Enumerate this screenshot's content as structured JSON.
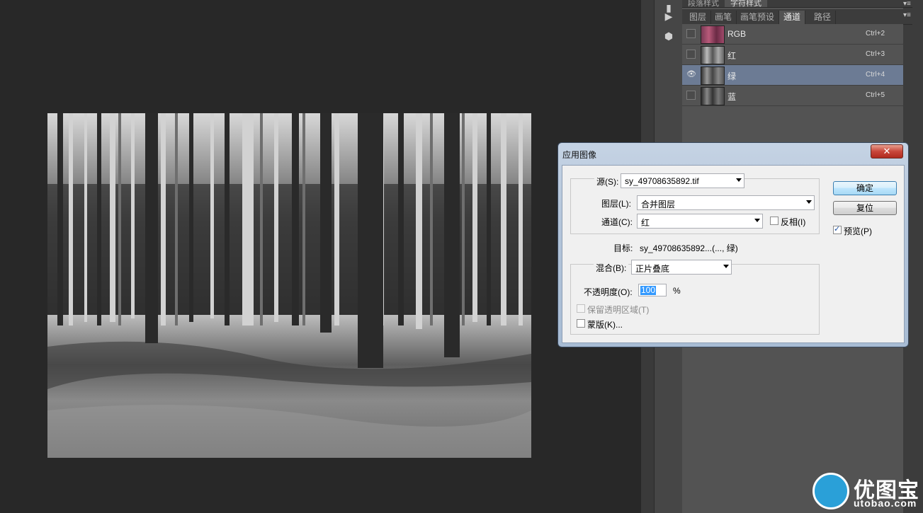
{
  "panels": {
    "top_tabs": [
      "段落样式",
      "字符样式"
    ],
    "tabs": [
      "图层",
      "画笔",
      "画笔预设",
      "通道",
      "路径"
    ],
    "active_tab": "通道",
    "channels": [
      {
        "name": "RGB",
        "shortcut": "Ctrl+2",
        "visible": false,
        "selected": false
      },
      {
        "name": "红",
        "shortcut": "Ctrl+3",
        "visible": false,
        "selected": false
      },
      {
        "name": "绿",
        "shortcut": "Ctrl+4",
        "visible": true,
        "selected": true
      },
      {
        "name": "蓝",
        "shortcut": "Ctrl+5",
        "visible": false,
        "selected": false
      }
    ]
  },
  "dialog": {
    "title": "应用图像",
    "source_label": "源(S):",
    "source_value": "sy_49708635892.tif",
    "layer_label": "图层(L):",
    "layer_value": "合并图层",
    "channel_label": "通道(C):",
    "channel_value": "红",
    "invert_label": "反相(I)",
    "invert_checked": false,
    "target_label": "目标:",
    "target_value": "sy_49708635892...(..., 绿)",
    "blend_label": "混合(B):",
    "blend_value": "正片叠底",
    "opacity_label": "不透明度(O):",
    "opacity_value": "100",
    "opacity_unit": "%",
    "preserve_label": "保留透明区域(T)",
    "mask_label": "蒙版(K)...",
    "ok_label": "确定",
    "reset_label": "复位",
    "preview_label": "预览(P)",
    "preview_checked": true,
    "close_glyph": "✕"
  },
  "watermark": {
    "text": "优图宝",
    "url": "utobao.com"
  }
}
